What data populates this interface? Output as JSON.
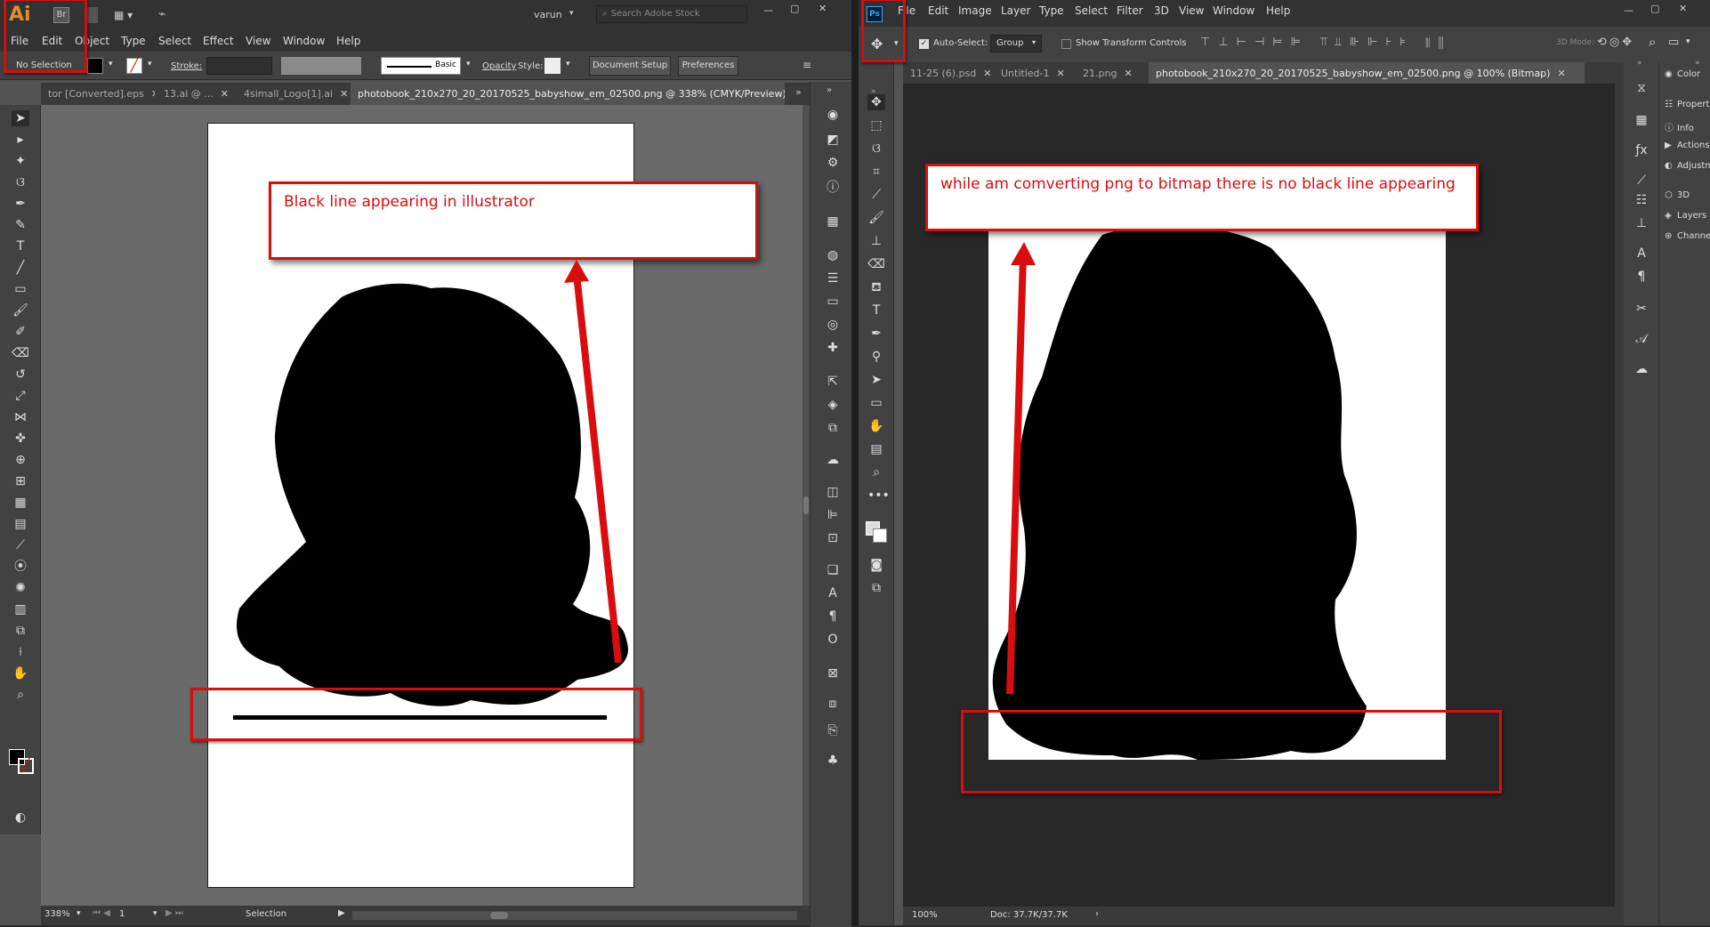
{
  "illustrator": {
    "app_icon": "Ai",
    "bridge_icon": "Br",
    "user": "varun",
    "search_placeholder": "Search Adobe Stock",
    "menu": [
      "File",
      "Edit",
      "Object",
      "Type",
      "Select",
      "Effect",
      "View",
      "Window",
      "Help"
    ],
    "control": {
      "selection": "No Selection",
      "stroke_label": "Stroke:",
      "brush_label": "Basic",
      "opacity_label": "Opacity",
      "style_label": "Style:",
      "doc_setup": "Document Setup",
      "preferences": "Preferences"
    },
    "tabs": [
      {
        "label": "tor [Converted].eps"
      },
      {
        "label": "13.ai @ ..."
      },
      {
        "label": "4simall_Logo[1].ai"
      },
      {
        "label": "photobook_210x270_20_20170525_babyshow_em_02500.png @ 338% (CMYK/Preview)"
      }
    ],
    "status": {
      "zoom": "338%",
      "page": "1",
      "tool": "Selection"
    },
    "callout": "Black line appearing in illustrator"
  },
  "photoshop": {
    "app_icon": "Ps",
    "menu": [
      "File",
      "Edit",
      "Image",
      "Layer",
      "Type",
      "Select",
      "Filter",
      "3D",
      "View",
      "Window",
      "Help"
    ],
    "control": {
      "auto_select": "Auto-Select:",
      "group": "Group",
      "show_transform": "Show Transform Controls",
      "mode_3d": "3D Mode:"
    },
    "tabs": [
      {
        "label": "11-25 (6).psd"
      },
      {
        "label": "Untitled-1"
      },
      {
        "label": "21.png"
      },
      {
        "label": "photobook_210x270_20_20170525_babyshow_em_02500.png @ 100% (Bitmap)"
      }
    ],
    "panels": [
      {
        "label": "Color",
        "icon": "color-icon"
      },
      {
        "label": "Properties",
        "icon": "properties-icon"
      },
      {
        "label": "Info",
        "icon": "info-icon"
      },
      {
        "label": "Actions",
        "icon": "actions-icon"
      },
      {
        "label": "Adjustm...",
        "icon": "adjustments-icon"
      },
      {
        "label": "3D",
        "icon": "cube-icon"
      },
      {
        "label": "Layers",
        "icon": "layers-icon"
      },
      {
        "label": "Channels",
        "icon": "channels-icon"
      }
    ],
    "status": {
      "zoom": "100%",
      "doc": "Doc: 37.7K/37.7K"
    },
    "callout": "while am comverting png to bitmap there is no black line appearing"
  },
  "colors": {
    "annotation_red": "#d90d0d",
    "ai_orange": "#e38d2b",
    "ps_blue": "#31a8ff"
  }
}
